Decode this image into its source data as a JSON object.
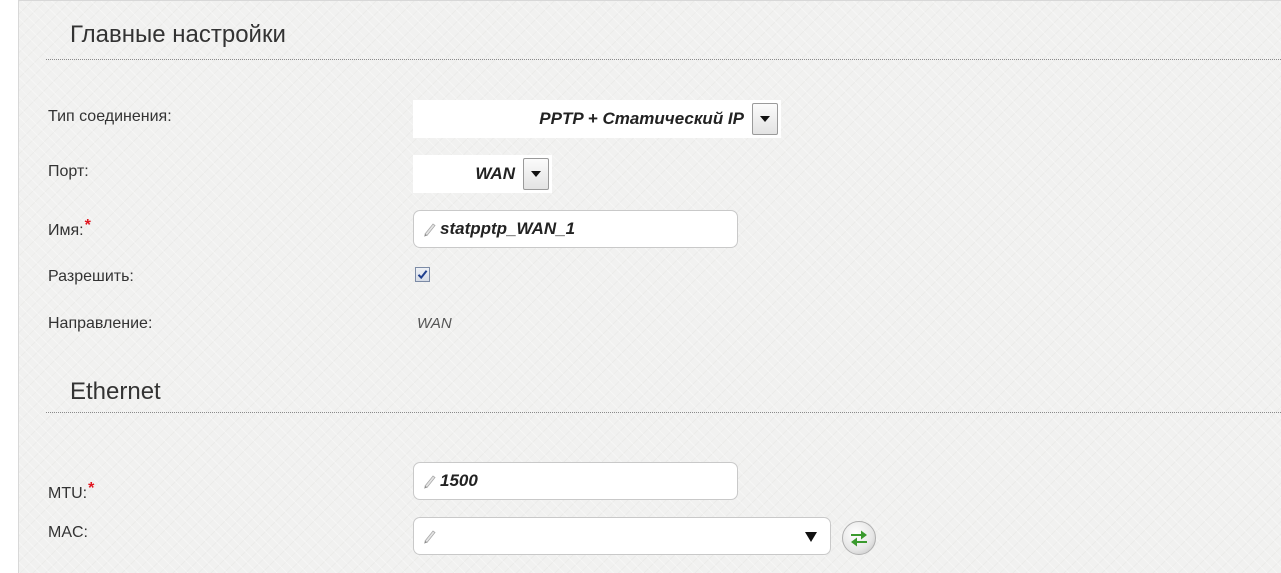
{
  "sections": {
    "main": {
      "title": "Главные настройки"
    },
    "ethernet": {
      "title": "Ethernet"
    }
  },
  "fields": {
    "connection_type": {
      "label": "Тип соединения:",
      "value": "PPTP + Статический IP"
    },
    "port": {
      "label": "Порт:",
      "value": "WAN"
    },
    "name": {
      "label": "Имя:",
      "required_mark": "*",
      "value": "statpptp_WAN_1"
    },
    "enable": {
      "label": "Разрешить:",
      "checked": true
    },
    "direction": {
      "label": "Направление:",
      "value": "WAN"
    },
    "mtu": {
      "label": "MTU:",
      "required_mark": "*",
      "value": "1500"
    },
    "mac": {
      "label": "MAC:",
      "value": ""
    }
  },
  "icons": {
    "select_arrow": "chevron-down-icon",
    "input_pencil": "pencil-icon",
    "mac_clone": "refresh-arrows-icon",
    "checkbox_check": "check-icon"
  },
  "colors": {
    "required": "#e0141e",
    "refresh_arrows": "#3a9a2e",
    "checkmark": "#1f3f8f"
  }
}
